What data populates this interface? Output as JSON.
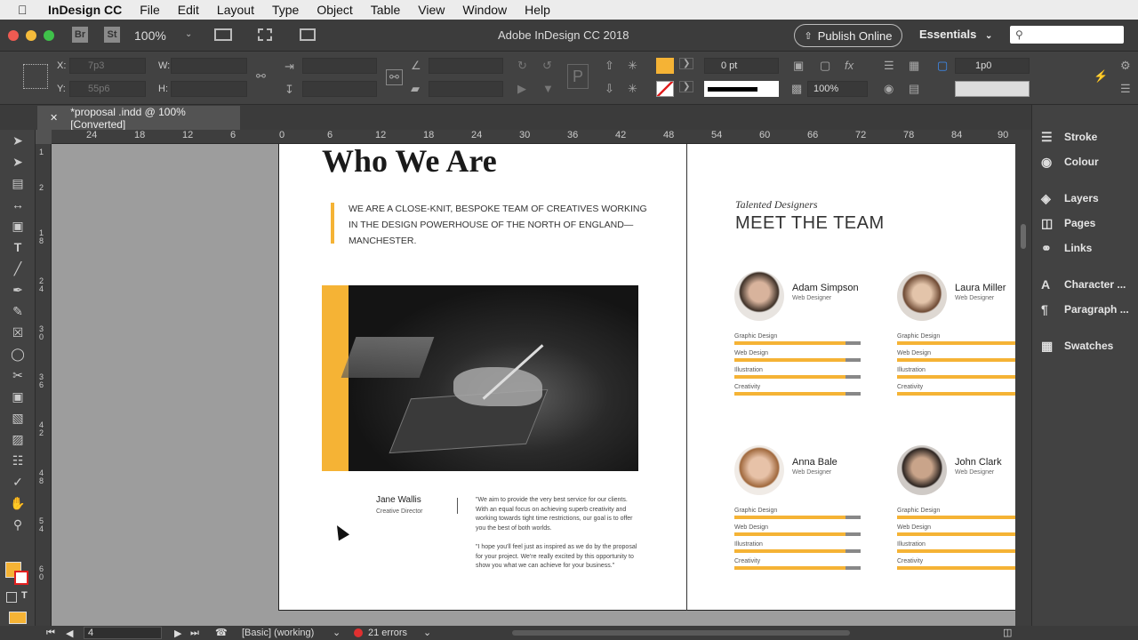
{
  "menubar": {
    "app_name": "InDesign CC",
    "items": [
      "File",
      "Edit",
      "Layout",
      "Type",
      "Object",
      "Table",
      "View",
      "Window",
      "Help"
    ]
  },
  "titlebar": {
    "bridge": "Br",
    "stock": "St",
    "zoom": "100%",
    "title": "Adobe InDesign CC 2018",
    "publish_label": "Publish Online",
    "workspace": "Essentials",
    "search_placeholder": ""
  },
  "controlbar": {
    "x_label": "X:",
    "y_label": "Y:",
    "w_label": "W:",
    "h_label": "H:",
    "x_value": "7p3",
    "y_value": "55p6",
    "stroke_weight": "0 pt",
    "scale": "100%",
    "gap": "1p0"
  },
  "tab": {
    "title": "*proposal .indd @ 100% [Converted]"
  },
  "ruler": {
    "h_ticks": [
      "24",
      "18",
      "12",
      "6",
      "0",
      "6",
      "12",
      "18",
      "24",
      "30",
      "36",
      "42",
      "48",
      "54",
      "60",
      "66",
      "72",
      "78",
      "84",
      "90"
    ],
    "v_ticks": [
      "1",
      "2",
      "1 8",
      "2 4",
      "3 0",
      "3 6",
      "4 2",
      "4 8",
      "5 4",
      "6 0"
    ]
  },
  "panels": [
    "Stroke",
    "Colour",
    "Layers",
    "Pages",
    "Links",
    "Character ...",
    "Paragraph ...",
    "Swatches"
  ],
  "doc": {
    "heading": "Who We Are",
    "intro": "WE ARE A CLOSE-KNIT, BESPOKE TEAM OF CREATIVES WORKING IN THE DESIGN POWERHOUSE OF THE NORTH OF ENGLAND—MANCHESTER.",
    "person_name": "Jane Wallis",
    "person_role": "Creative Director",
    "quote1": "\"We aim to provide the very best service for our clients. With an equal focus on achieving superb creativity and working towards tight time restrictions, our goal is to offer you the best of both worlds.",
    "quote2": "\"I hope you'll feel just as inspired as we do by the proposal for your project. We're really excited by this opportunity to show you what we can achieve for your business.\"",
    "team_kicker": "Talented Designers",
    "team_title": "MEET THE TEAM",
    "skills": [
      "Graphic Design",
      "Web Design",
      "Illustration",
      "Creativity"
    ],
    "members": [
      {
        "name": "Adam Simpson",
        "role": "Web Designer",
        "levels": [
          0.88,
          0.88,
          0.88,
          0.88
        ]
      },
      {
        "name": "Laura Miller",
        "role": "Web Designer",
        "levels": [
          0.98,
          0.98,
          0.98,
          0.98
        ]
      },
      {
        "name": "Anna Bale",
        "role": "Web Designer",
        "levels": [
          0.88,
          0.88,
          0.88,
          0.88
        ]
      },
      {
        "name": "John Clark",
        "role": "Web Designer",
        "levels": [
          0.98,
          0.98,
          0.98,
          0.98
        ]
      }
    ]
  },
  "status": {
    "page": "4",
    "style": "[Basic] (working)",
    "errors": "21 errors"
  },
  "colors": {
    "accent": "#f5b335",
    "fill_swatch": "#f5b335"
  }
}
